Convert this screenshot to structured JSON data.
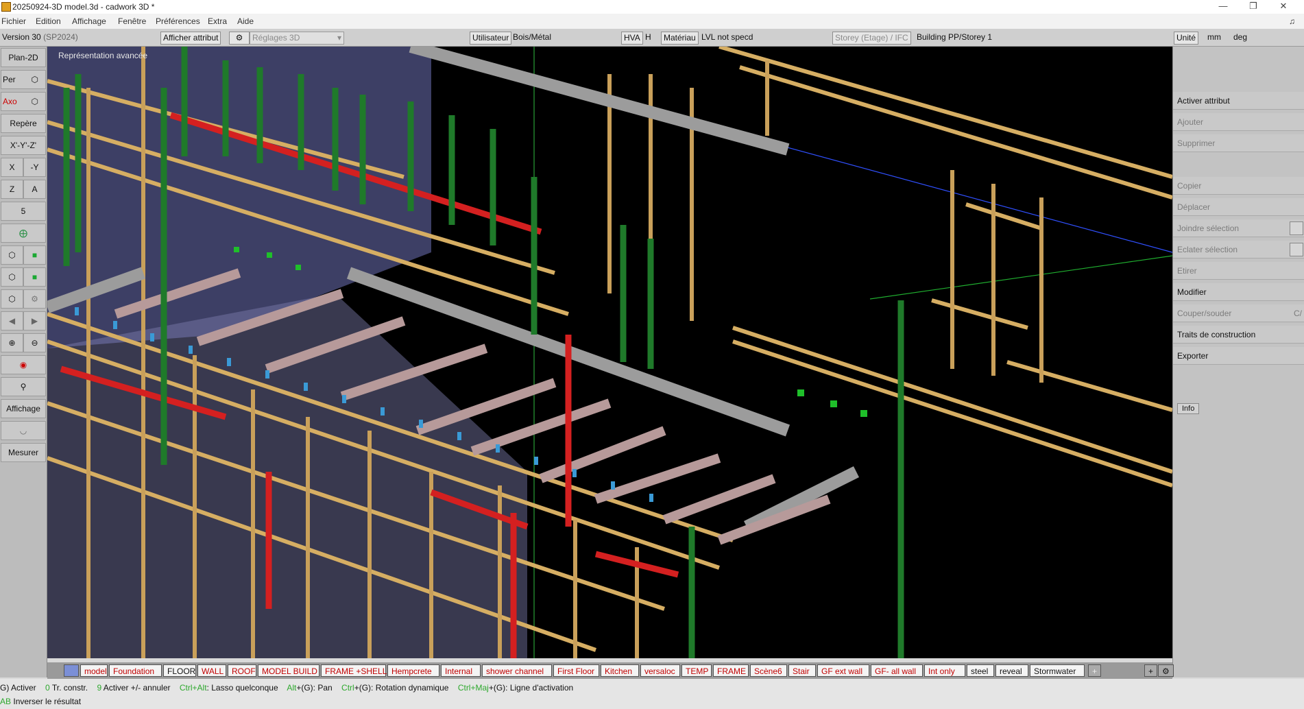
{
  "window": {
    "title": "20250924-3D model.3d - cadwork 3D *"
  },
  "menu": [
    "Fichier",
    "Edition",
    "Affichage",
    "Fenêtre",
    "Préférences",
    "Extra",
    "Aide"
  ],
  "infobar": {
    "version": "Version 30",
    "version_sp": "(SP2024)",
    "afficher_attribut": "Afficher attribut",
    "reglages": "Réglages 3D",
    "utilisateur": "Utilisateur",
    "bois_metal": "Bois/Métal",
    "hva": "HVA",
    "h": "H",
    "materiau": "Matériau",
    "lvl": "LVL not specd",
    "storey": "Storey (Etage) / IFC",
    "building": "Building PP/Storey 1",
    "unite": "Unité",
    "mm": "mm",
    "deg": "deg"
  },
  "left_toolbar": {
    "plan2d": "Plan-2D",
    "per": "Per",
    "axo": "Axo",
    "repere": "Repère",
    "xyz": "X'-Y'-Z'",
    "x": "X",
    "neg_y": "-Y",
    "z": "Z",
    "a": "A",
    "five": "5",
    "affichage": "Affichage",
    "mesurer": "Mesurer"
  },
  "viewport": {
    "label": "Représentation avancée"
  },
  "right_panel": {
    "activer_attribut": "Activer attribut",
    "ajouter": "Ajouter",
    "supprimer": "Supprimer",
    "copier": "Copier",
    "deplacer": "Déplacer",
    "joindre": "Joindre sélection",
    "eclater": "Eclater sélection",
    "etirer": "Etirer",
    "modifier": "Modifier",
    "couper": "Couper/souder",
    "couper_short": "C/",
    "traits": "Traits de construction",
    "exporter": "Exporter",
    "info": "Info"
  },
  "tabs": [
    {
      "label": "model",
      "color": "red"
    },
    {
      "label": "Foundation",
      "color": "red"
    },
    {
      "label": "FLOOR",
      "color": "black"
    },
    {
      "label": "WALL",
      "color": "red"
    },
    {
      "label": "ROOF",
      "color": "red"
    },
    {
      "label": "MODEL BUILD",
      "color": "red"
    },
    {
      "label": "FRAME +SHELL",
      "color": "red"
    },
    {
      "label": "Hempcrete",
      "color": "red"
    },
    {
      "label": "Internal",
      "color": "red"
    },
    {
      "label": "shower channel",
      "color": "red"
    },
    {
      "label": "First Floor",
      "color": "red"
    },
    {
      "label": "Kitchen",
      "color": "red"
    },
    {
      "label": "versaloc",
      "color": "red"
    },
    {
      "label": "TEMP",
      "color": "red"
    },
    {
      "label": "FRAME",
      "color": "red"
    },
    {
      "label": "Scène6",
      "color": "red"
    },
    {
      "label": "Stair",
      "color": "red"
    },
    {
      "label": "GF ext wall",
      "color": "red"
    },
    {
      "label": "GF- all wall",
      "color": "red"
    },
    {
      "label": "Int only",
      "color": "red"
    },
    {
      "label": "steel",
      "color": "black"
    },
    {
      "label": "reveal",
      "color": "black"
    },
    {
      "label": "Stormwater",
      "color": "black"
    }
  ],
  "status": {
    "activer": "G) Activer",
    "zero": "0",
    "tr_constr": "Tr. constr.",
    "nine": "9",
    "activer_annuler": "Activer +/- annuler",
    "ctrl_alt": "Ctrl+Alt",
    "lasso": ": Lasso quelconque",
    "alt": "Alt",
    "pan": "+(G): Pan",
    "ctrl": "Ctrl",
    "rotation": "+(G): Rotation dynamique",
    "ctrl_maj": "Ctrl+Maj",
    "ligne": "+(G): Ligne d'activation",
    "ab": "AB",
    "inverser": "Inverser le résultat"
  },
  "colors": {
    "viewport_bg": "#000000",
    "timber": "#d9b36a",
    "steel": "#9a9a9a",
    "green_member": "#1f7a2a",
    "red_member": "#d42020",
    "purple_panel": "#7b7fc0"
  }
}
